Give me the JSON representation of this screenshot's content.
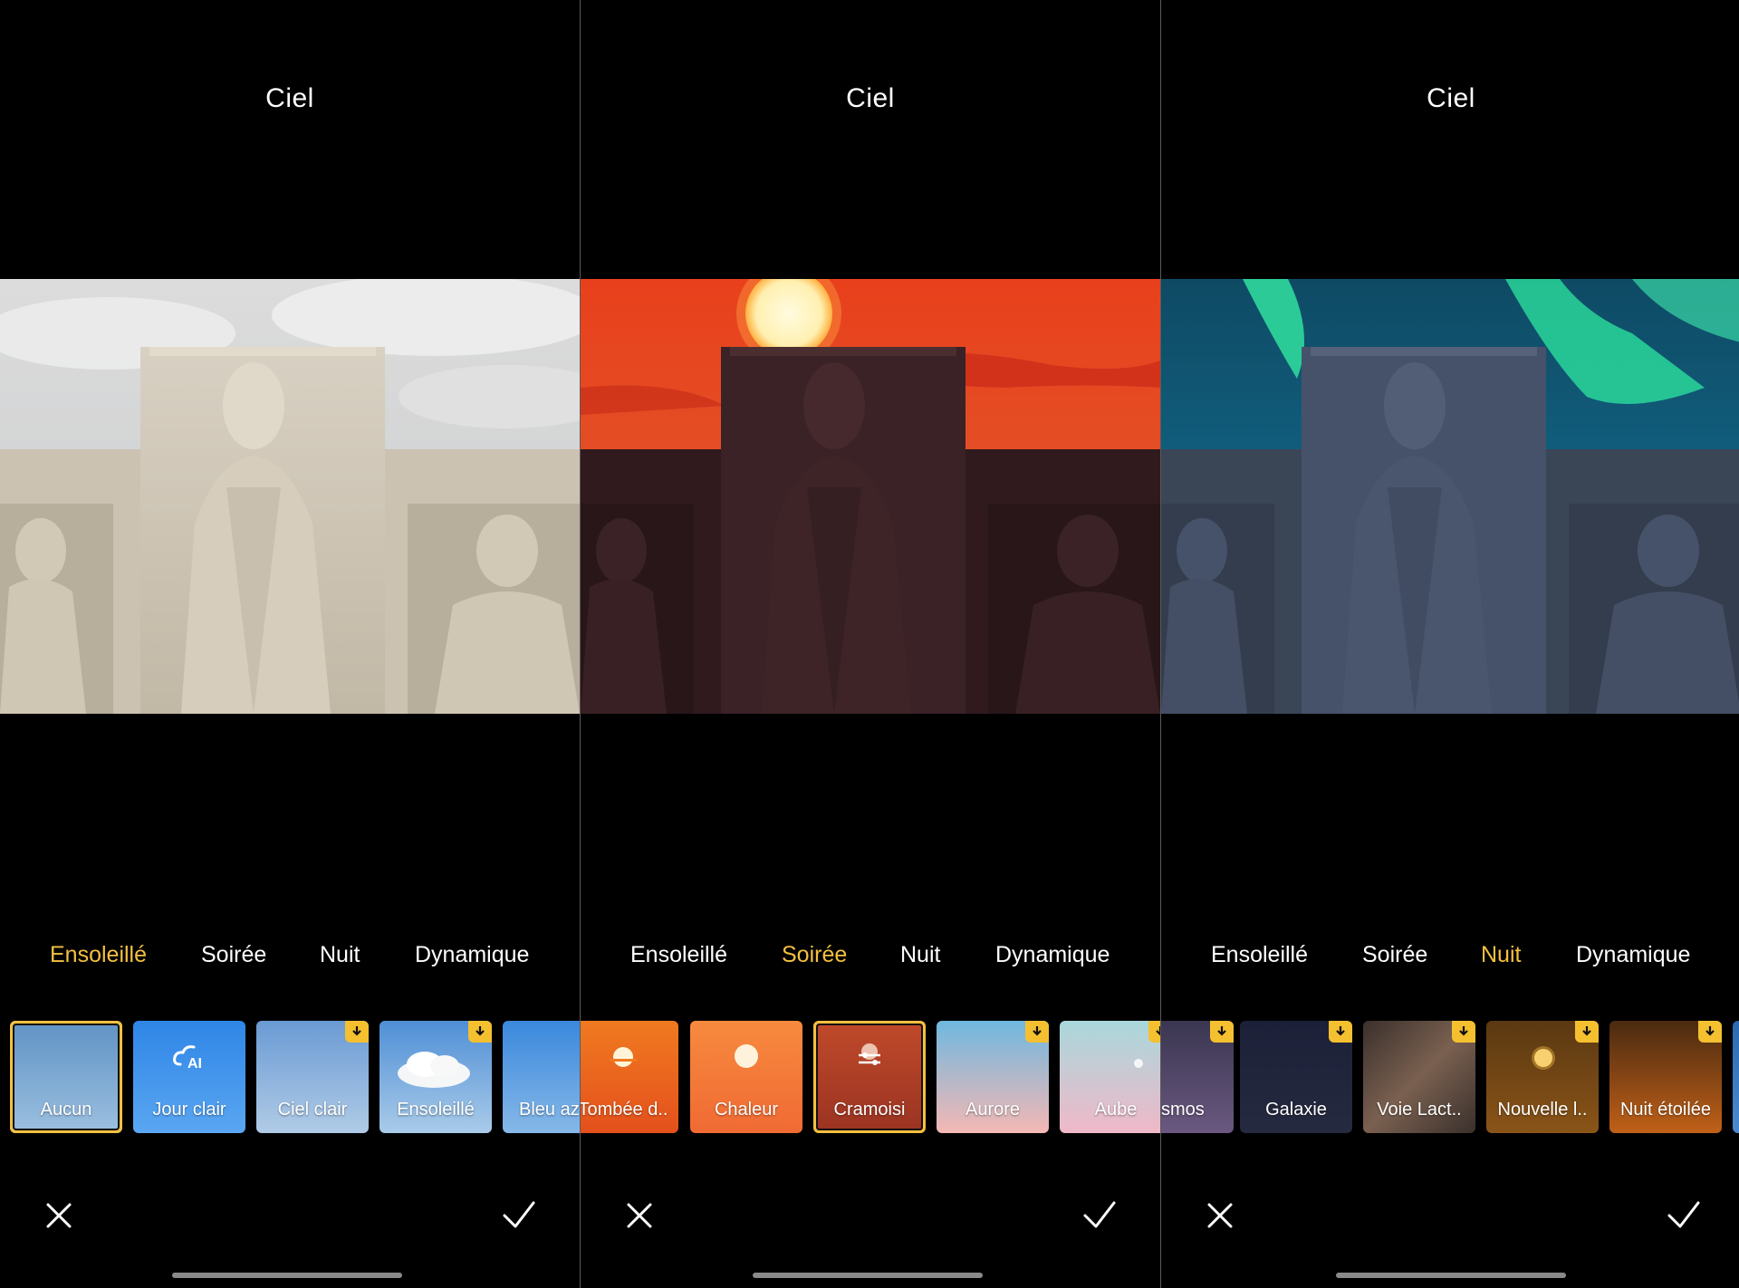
{
  "panels": [
    {
      "title": "Ciel",
      "tabs": [
        "Ensoleillé",
        "Soirée",
        "Nuit",
        "Dynamique"
      ],
      "active_tab": "Ensoleillé",
      "thumbnails": [
        {
          "label": "Aucun",
          "selected": true,
          "download": false
        },
        {
          "label": "Jour clair",
          "selected": false,
          "download": false,
          "icon": "ai-cloud-icon"
        },
        {
          "label": "Ciel clair",
          "selected": false,
          "download": true
        },
        {
          "label": "Ensoleillé",
          "selected": false,
          "download": true
        },
        {
          "label": "Bleu az",
          "selected": false,
          "download": false
        }
      ]
    },
    {
      "title": "Ciel",
      "tabs": [
        "Ensoleillé",
        "Soirée",
        "Nuit",
        "Dynamique"
      ],
      "active_tab": "Soirée",
      "thumbnails": [
        {
          "label": "Tombée d..",
          "selected": false,
          "download": false
        },
        {
          "label": "Chaleur",
          "selected": false,
          "download": false
        },
        {
          "label": "Cramoisi",
          "selected": true,
          "download": false,
          "icon": "adjust-sliders-icon"
        },
        {
          "label": "Aurore",
          "selected": false,
          "download": true
        },
        {
          "label": "Aube",
          "selected": false,
          "download": true
        }
      ]
    },
    {
      "title": "Ciel",
      "tabs": [
        "Ensoleillé",
        "Soirée",
        "Nuit",
        "Dynamique"
      ],
      "active_tab": "Nuit",
      "thumbnails": [
        {
          "label": "smos",
          "selected": false,
          "download": true
        },
        {
          "label": "Galaxie",
          "selected": false,
          "download": true
        },
        {
          "label": "Voie Lact..",
          "selected": false,
          "download": true
        },
        {
          "label": "Nouvelle l..",
          "selected": false,
          "download": true
        },
        {
          "label": "Nuit étoilée",
          "selected": false,
          "download": true
        }
      ]
    }
  ],
  "actions": {
    "cancel_icon": "close-icon",
    "confirm_icon": "check-icon"
  },
  "colors": {
    "accent": "#f4c040",
    "background": "#000000",
    "badge": "#f4c030"
  }
}
